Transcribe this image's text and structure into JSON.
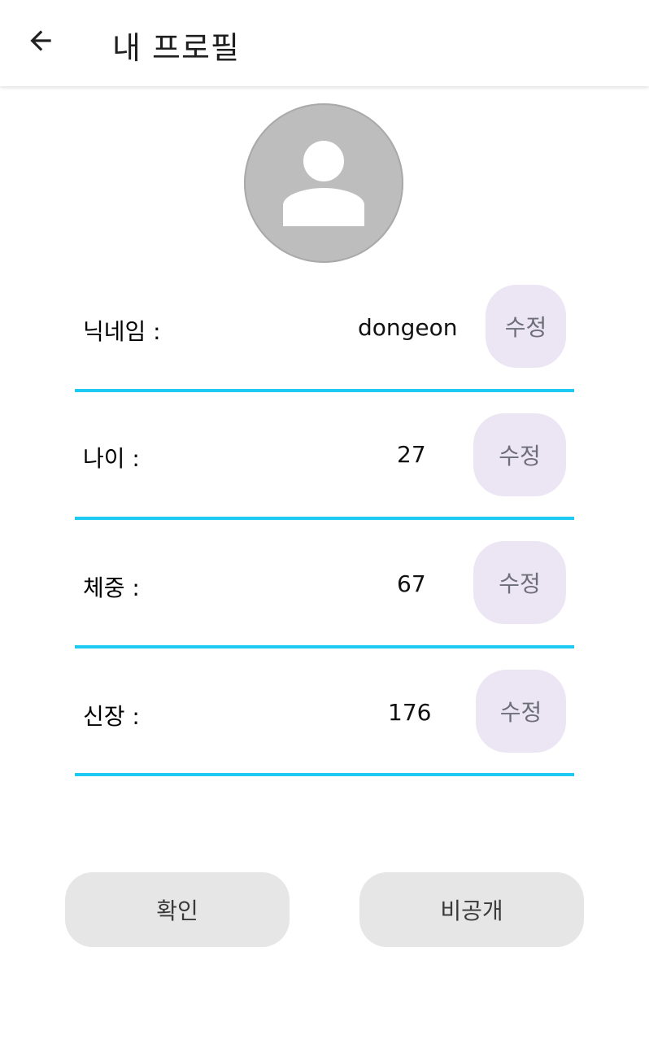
{
  "header": {
    "title": "내 프로필",
    "back_icon": "arrow-left-icon"
  },
  "avatar": {
    "icon": "person-icon"
  },
  "fields": [
    {
      "label": "닉네임 :",
      "value": "dongeon",
      "edit_label": "수정"
    },
    {
      "label": "나이 :",
      "value": "27",
      "edit_label": "수정"
    },
    {
      "label": "체중 :",
      "value": "67",
      "edit_label": "수정"
    },
    {
      "label": "신장 :",
      "value": "176",
      "edit_label": "수정"
    }
  ],
  "actions": {
    "confirm_label": "확인",
    "private_label": "비공개"
  },
  "colors": {
    "divider": "#1ec9f2",
    "edit_button_bg": "#ece6f4",
    "action_button_bg": "#e6e6e6",
    "avatar_bg": "#bdbdbd"
  }
}
